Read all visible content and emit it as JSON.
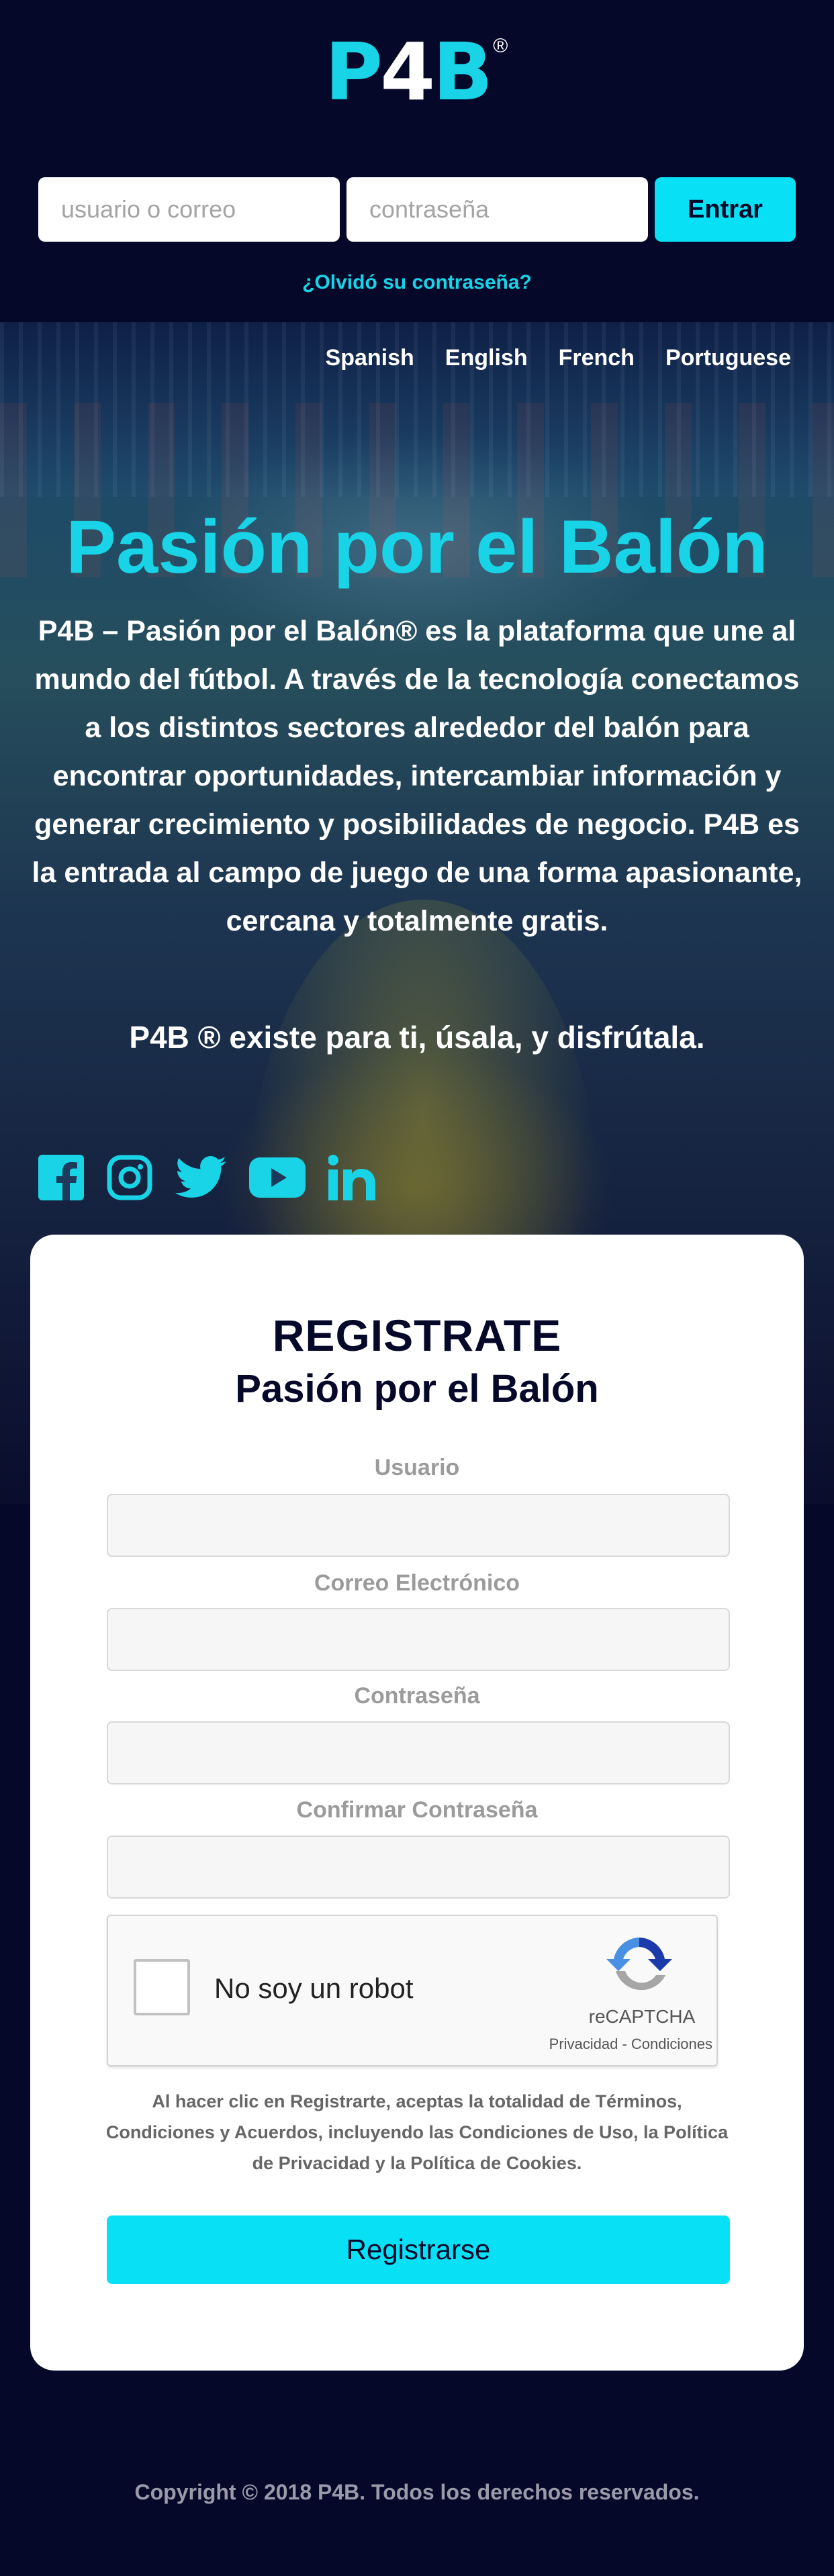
{
  "brand": {
    "logo_text_p": "P",
    "logo_text_4": "4",
    "logo_text_b": "B",
    "logo_registered": "®",
    "accent_color": "#19d3e6",
    "background_color": "#06082a"
  },
  "login": {
    "username_placeholder": "usuario o correo",
    "password_placeholder": "contraseña",
    "submit_label": "Entrar",
    "forgot_password": "¿Olvidó su contraseña?"
  },
  "languages": [
    "Spanish",
    "English",
    "French",
    "Portuguese"
  ],
  "hero": {
    "title": "Pasión por el Balón",
    "description": "P4B – Pasión por el Balón® es la plataforma que une al mundo del fútbol. A través de la tecnología conectamos a los distintos sectores alrededor del balón para encontrar oportunidades, intercambiar información y generar crecimiento y posibilidades de negocio. P4B es la entrada al campo de juego de una forma apasionante, cercana y totalmente gratis.",
    "tagline": "P4B ® existe para ti, úsala, y disfrútala."
  },
  "social": [
    {
      "name": "facebook-icon"
    },
    {
      "name": "instagram-icon"
    },
    {
      "name": "twitter-icon"
    },
    {
      "name": "youtube-icon"
    },
    {
      "name": "linkedin-icon"
    }
  ],
  "register": {
    "title": "REGISTRATE",
    "subtitle": "Pasión por el Balón",
    "fields": [
      {
        "label": "Usuario",
        "value": ""
      },
      {
        "label": "Correo Electrónico",
        "value": ""
      },
      {
        "label": "Contraseña",
        "value": ""
      },
      {
        "label": "Confirmar Contraseña",
        "value": ""
      }
    ],
    "captcha": {
      "label": "No soy un robot",
      "brand": "reCAPTCHA",
      "links": "Privacidad - Condiciones",
      "checked": false
    },
    "terms": "Al hacer clic en Registrarte, aceptas la totalidad de Términos, Condiciones y Acuerdos, incluyendo las Condiciones de Uso, la Política de Privacidad y la Política de Cookies.",
    "submit_label": "Registrarse"
  },
  "footer": {
    "copyright": "Copyright © 2018 P4B. Todos los derechos reservados."
  }
}
